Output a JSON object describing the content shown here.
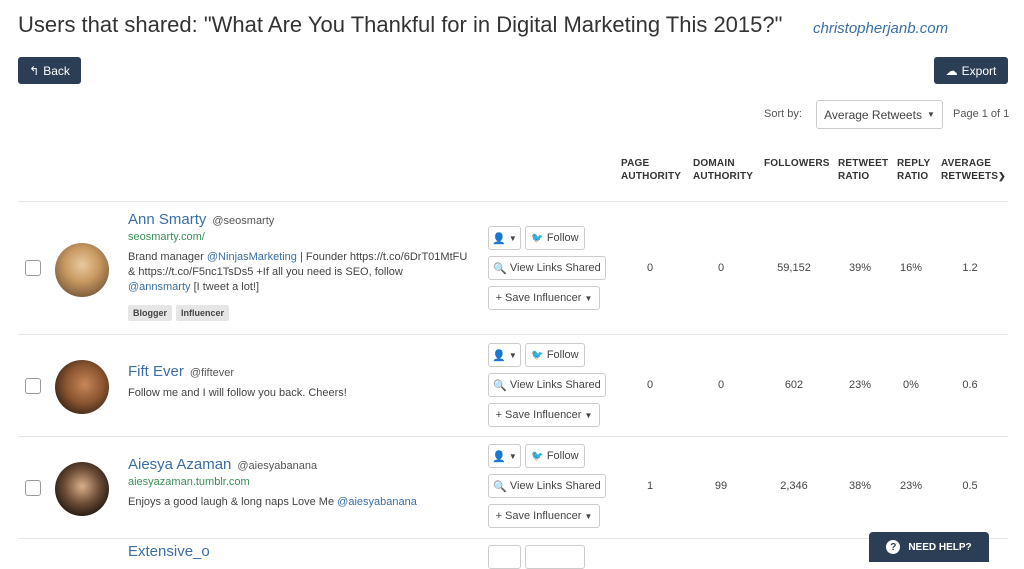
{
  "header": {
    "title": "Users that shared: \"What Are You Thankful for in Digital Marketing This 2015?\"",
    "site": "christopherjanb.com",
    "back_label": "Back",
    "export_label": "Export"
  },
  "sort": {
    "label": "Sort by:",
    "selected": "Average Retweets",
    "page_info": "Page 1 of 1"
  },
  "columns": {
    "page_authority_1": "PAGE",
    "page_authority_2": "AUTHORITY",
    "domain_authority_1": "DOMAIN",
    "domain_authority_2": "AUTHORITY",
    "followers": "FOLLOWERS",
    "retweet_ratio_1": "RETWEET",
    "retweet_ratio_2": "RATIO",
    "reply_ratio_1": "REPLY",
    "reply_ratio_2": "RATIO",
    "average_retweets_1": "AVERAGE",
    "average_retweets_2": "RETWEETS"
  },
  "actions": {
    "follow": "Follow",
    "view_links": "View Links Shared",
    "save": "Save Influencer"
  },
  "users": [
    {
      "name": "Ann Smarty",
      "handle": "@seosmarty",
      "url": "seosmarty.com/",
      "bio_1": "Brand manager ",
      "bio_link_1": "@NinjasMarketing",
      "bio_2": " | Founder https://t.co/6DrT01MtFU & https://t.co/F5nc1TsDs5 +If all you need is SEO, follow ",
      "bio_link_2": "@annsmarty",
      "bio_3": " [I tweet a lot!]",
      "tags": [
        "Blogger",
        "Influencer"
      ],
      "page_authority": "0",
      "domain_authority": "0",
      "followers": "59,152",
      "retweet_ratio": "39%",
      "reply_ratio": "16%",
      "average_retweets": "1.2"
    },
    {
      "name": "Fift Ever",
      "handle": "@fiftever",
      "bio_1": "Follow me and I will follow you back. Cheers!",
      "page_authority": "0",
      "domain_authority": "0",
      "followers": "602",
      "retweet_ratio": "23%",
      "reply_ratio": "0%",
      "average_retweets": "0.6"
    },
    {
      "name": "Aiesya Azaman",
      "handle": "@aiesyabanana",
      "url": "aiesyazaman.tumblr.com",
      "bio_1": "Enjoys a good laugh & long naps Love Me ",
      "bio_link_1": "@aiesyabanana",
      "page_authority": "1",
      "domain_authority": "99",
      "followers": "2,346",
      "retweet_ratio": "38%",
      "reply_ratio": "23%",
      "average_retweets": "0.5"
    },
    {
      "name": "Extensive_o"
    }
  ],
  "help": {
    "label": "NEED HELP?"
  },
  "colors": {
    "primary_dark": "#2c3e55",
    "link_blue": "#3a6ea5",
    "url_green": "#3a8f5a"
  }
}
